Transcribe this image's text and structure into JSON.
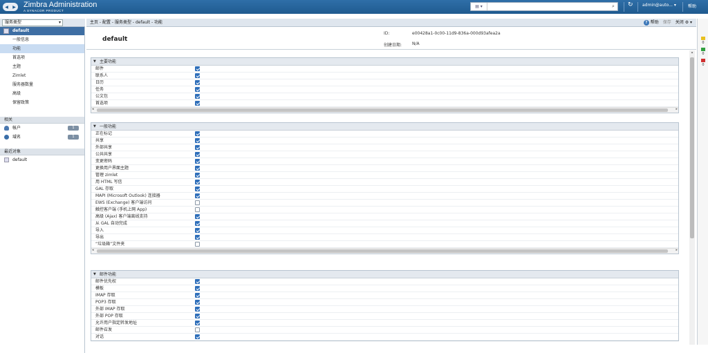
{
  "app": {
    "title": "Zimbra Administration",
    "subtitle": "A SYNACOR PRODUCT"
  },
  "topbar": {
    "search_placeholder": "",
    "user": "admin@auto...",
    "help": "帮助",
    "refresh_icon": "refresh-icon"
  },
  "left": {
    "dropdown": "服务类型",
    "current": "default",
    "nav": [
      "一般信息",
      "功能",
      "首选项",
      "主题",
      "Zimlet",
      "服务器数量",
      "高级",
      "保留政策"
    ],
    "related_title": "相关",
    "related": [
      {
        "label": "帐户",
        "count": "1"
      },
      {
        "label": "域名",
        "count": "1"
      }
    ],
    "recent_title": "最近对象",
    "recent": [
      "default"
    ]
  },
  "breadcrumb": {
    "path": "主页 - 配置 - 服务类型 - default - 功能",
    "help": "帮助",
    "save": "保存",
    "close": "关闭"
  },
  "header": {
    "title": "default",
    "id_label": "ID:",
    "id_value": "e00428a1-0c00-11d9-836a-000d93afea2a",
    "created_label": "创建日期:",
    "created_value": "N/A"
  },
  "sections": [
    {
      "title": "主要功能",
      "rows": [
        {
          "label": "邮件",
          "checked": true
        },
        {
          "label": "联系人",
          "checked": true
        },
        {
          "label": "日历",
          "checked": true
        },
        {
          "label": "任务",
          "checked": true
        },
        {
          "label": "公文包",
          "checked": true
        },
        {
          "label": "首选项",
          "checked": true
        }
      ]
    },
    {
      "title": "一般功能",
      "rows": [
        {
          "label": "正在标记",
          "checked": true
        },
        {
          "label": "共享",
          "checked": true
        },
        {
          "label": "外部共享",
          "checked": true
        },
        {
          "label": "公共共享",
          "checked": true
        },
        {
          "label": "变更密码",
          "checked": true
        },
        {
          "label": "更换用户界面主题",
          "checked": true
        },
        {
          "label": "管理 zimlet",
          "checked": true
        },
        {
          "label": "用 HTML 写信",
          "checked": true
        },
        {
          "label": "GAL 存取",
          "checked": true
        },
        {
          "label": "MAPI (Microsoft Outlook) 连接器",
          "checked": true
        },
        {
          "label": "EWS (Exchange) 客户端访问",
          "checked": false
        },
        {
          "label": "触控客户端 (手机上网 App)",
          "checked": false
        },
        {
          "label": "高级 (Ajax) 客户端离线支持",
          "checked": true
        },
        {
          "label": "从 GAL 自动完成",
          "checked": true
        },
        {
          "label": "导入",
          "checked": true
        },
        {
          "label": "导出",
          "checked": true
        },
        {
          "label": "“垃圾箱”文件夹",
          "checked": false
        }
      ]
    },
    {
      "title": "邮件功能",
      "rows": [
        {
          "label": "邮件优先权",
          "checked": true
        },
        {
          "label": "模板",
          "checked": true
        },
        {
          "label": "IMAP 存取",
          "checked": true
        },
        {
          "label": "POP3 存取",
          "checked": true
        },
        {
          "label": "外部 IMAP 存取",
          "checked": true
        },
        {
          "label": "外部 POP 存取",
          "checked": true
        },
        {
          "label": "允许用户指定转发地址",
          "checked": true
        },
        {
          "label": "邮件召发",
          "checked": false
        },
        {
          "label": "对话",
          "checked": true
        }
      ]
    }
  ],
  "right_strip": [
    {
      "count": "0",
      "color": "#e8c020"
    },
    {
      "count": "0",
      "color": "#30a040"
    },
    {
      "count": "0",
      "color": "#d03030"
    }
  ],
  "colors": {
    "topbar": "#2f6fa8",
    "selected": "#c9dcf2",
    "checkbox": "#2f6fba"
  }
}
